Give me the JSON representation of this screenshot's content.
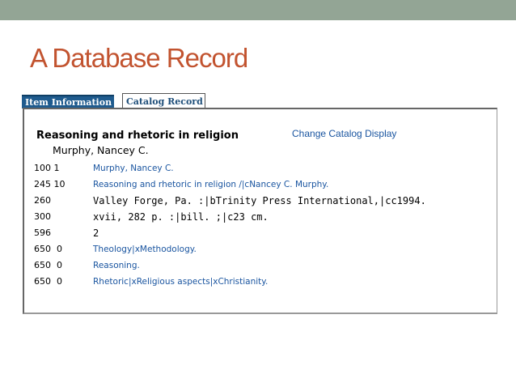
{
  "slide": {
    "title": "A Database Record"
  },
  "tabs": [
    {
      "label": "Item Information",
      "active": true
    },
    {
      "label": "Catalog Record",
      "active": false
    }
  ],
  "record": {
    "title": "Reasoning and rhetoric in religion",
    "author": "Murphy, Nancey C.",
    "change_display_link": "Change Catalog Display",
    "fields": [
      {
        "tag": "100 1",
        "value": "Murphy, Nancey C.",
        "style": "link"
      },
      {
        "tag": "245 10",
        "value": "Reasoning and rhetoric in religion /|cNancey C. Murphy.",
        "style": "link"
      },
      {
        "tag": "260",
        "value": "Valley Forge, Pa. :|bTrinity Press International,|cc1994.",
        "style": "mono"
      },
      {
        "tag": "300",
        "value": "xvii, 282 p. :|bill. ;|c23 cm.",
        "style": "mono"
      },
      {
        "tag": "596",
        "value": "2",
        "style": "mono"
      },
      {
        "tag": "650  0",
        "value": "Theology|xMethodology.",
        "style": "link"
      },
      {
        "tag": "650  0",
        "value": "Reasoning.",
        "style": "link"
      },
      {
        "tag": "650  0",
        "value": "Rhetoric|xReligious aspects|xChristianity.",
        "style": "link"
      }
    ]
  },
  "colors": {
    "band": "#93a595",
    "title": "#c2532f",
    "link": "#1a55a0",
    "active_tab": "#1f5b8e"
  }
}
